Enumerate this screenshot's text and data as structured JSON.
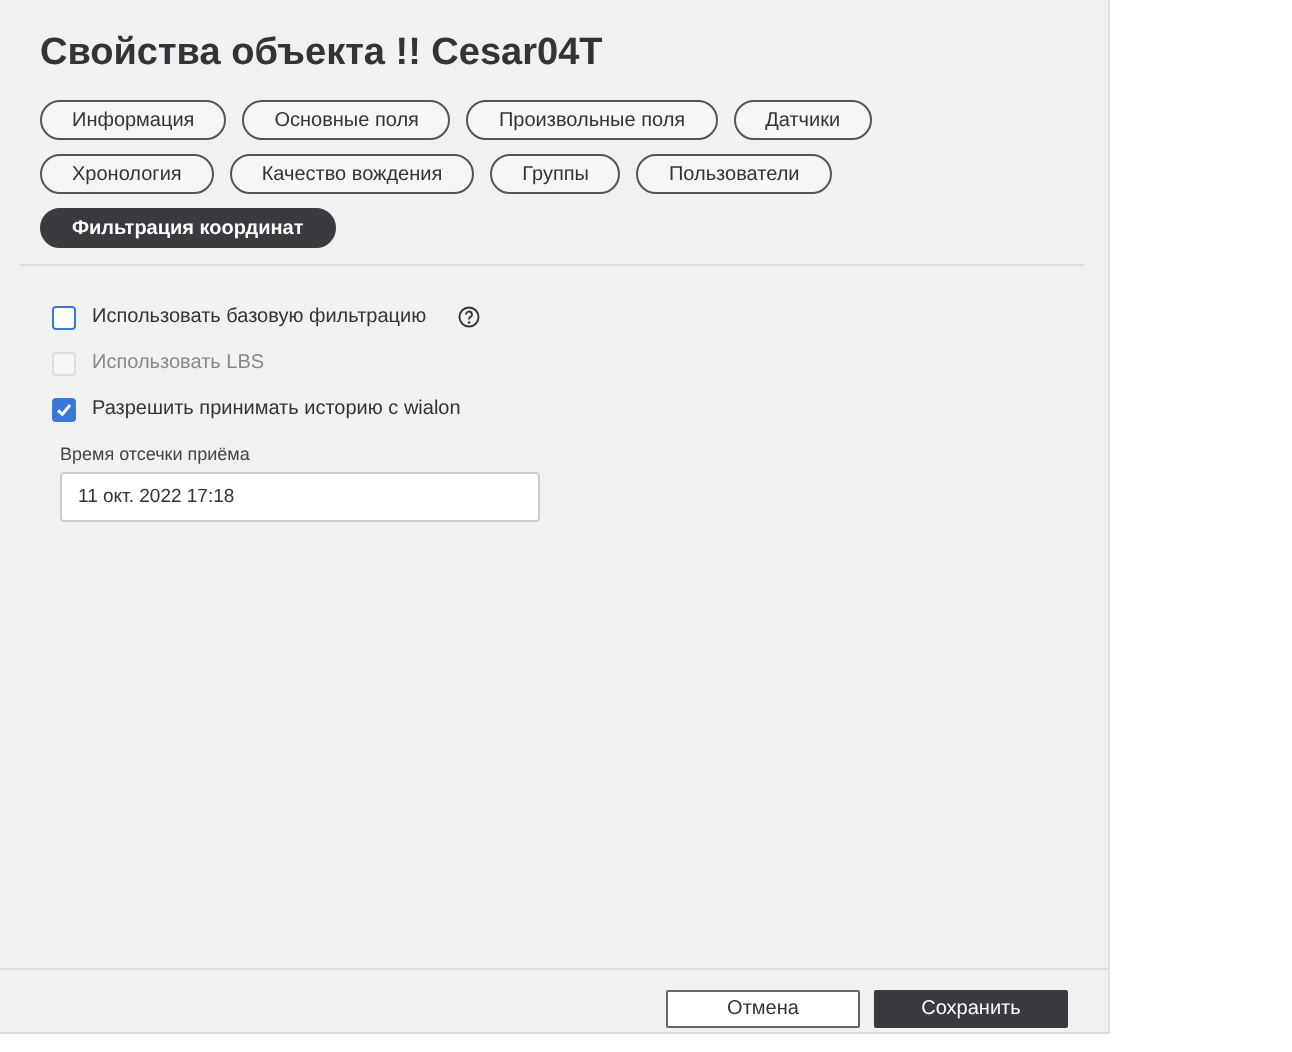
{
  "window": {
    "title": "Свойства объекта !! Cesar04T"
  },
  "tabs": [
    {
      "label": "Информация",
      "selected": false
    },
    {
      "label": "Основные поля",
      "selected": false
    },
    {
      "label": "Произвольные поля",
      "selected": false
    },
    {
      "label": "Датчики",
      "selected": false
    },
    {
      "label": "Хронология",
      "selected": false
    },
    {
      "label": "Качество вождения",
      "selected": false
    },
    {
      "label": "Группы",
      "selected": false
    },
    {
      "label": "Пользователи",
      "selected": false
    },
    {
      "label": "Фильтрация координат",
      "selected": true
    }
  ],
  "options": [
    {
      "label": "Использовать базовую фильтрацию",
      "checked": false,
      "disabled": false,
      "help": true
    },
    {
      "label": "Использовать LBS",
      "checked": false,
      "disabled": true,
      "help": false
    },
    {
      "label": "Разрешить принимать историю с wialon",
      "checked": true,
      "disabled": false,
      "help": false
    }
  ],
  "cutoff_field": {
    "label": "Время отсечки приёма",
    "value": "11 окт. 2022 17:18"
  },
  "buttons": [
    {
      "label": "Отмена",
      "kind": "secondary"
    },
    {
      "label": "Сохранить",
      "kind": "primary"
    }
  ]
}
